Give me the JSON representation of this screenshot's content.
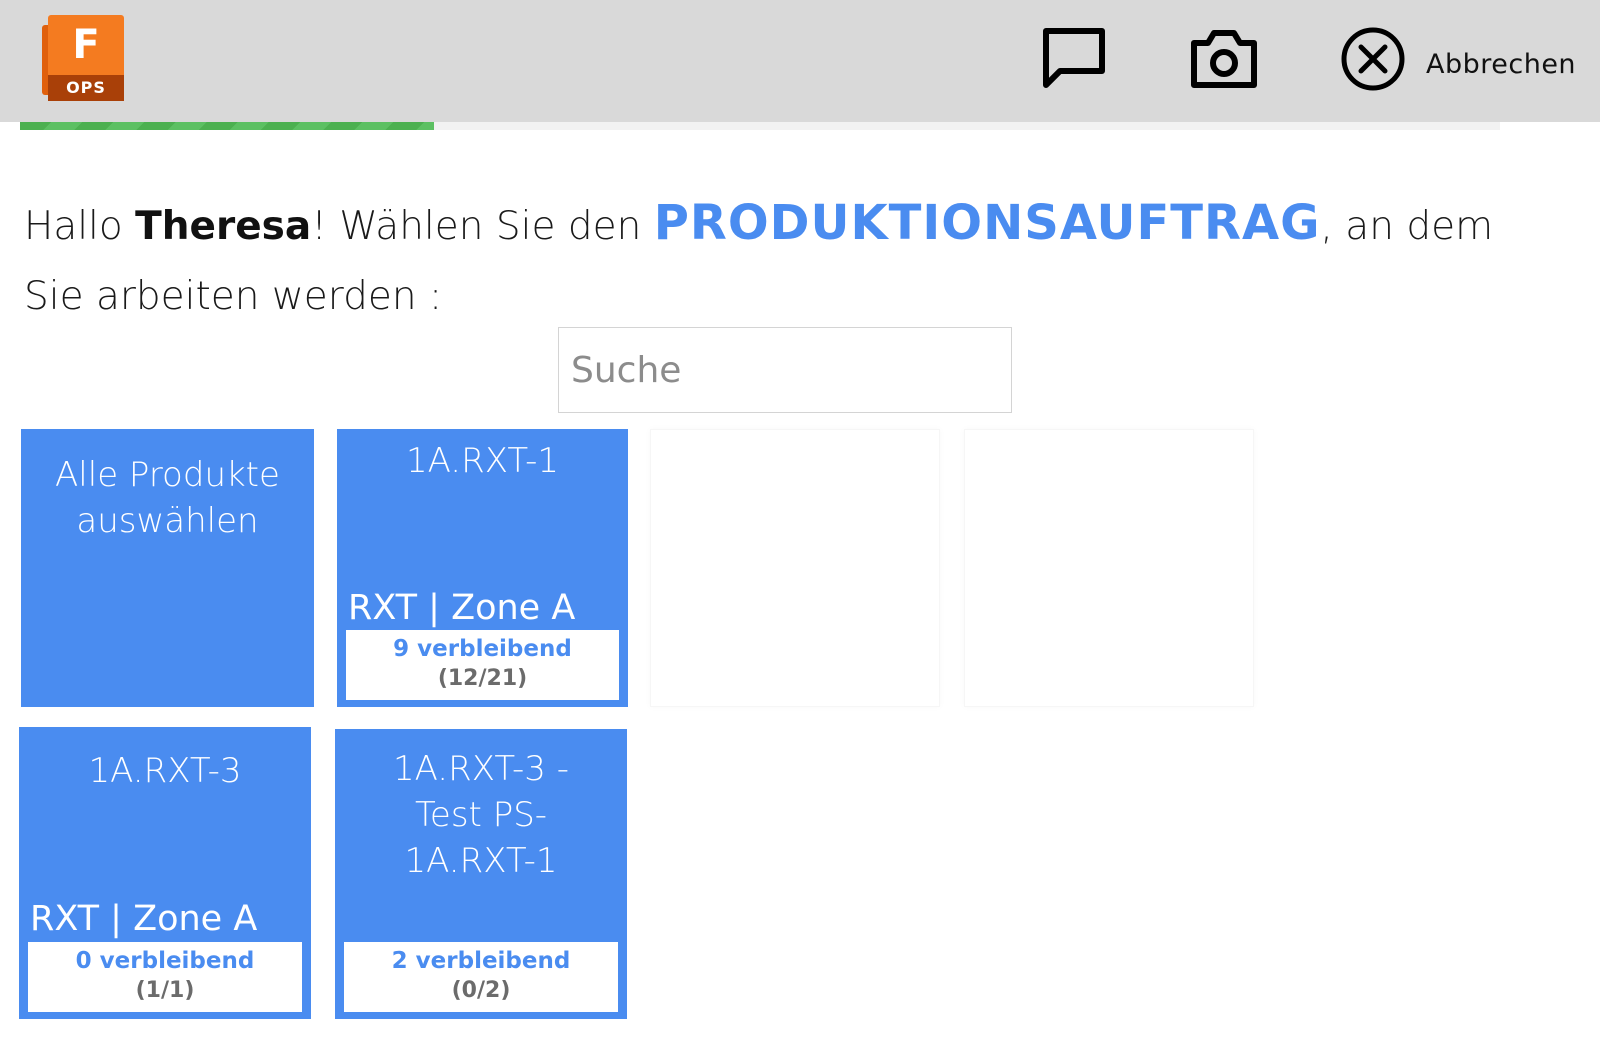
{
  "app": {
    "logo_letter": "F",
    "logo_badge": "OPS",
    "accent_color": "#4a8cf0",
    "progress_color": "#4cb050"
  },
  "header": {
    "icons": [
      "chat-icon",
      "camera-icon",
      "close-circle-icon"
    ],
    "cancel_label": "Abbrechen"
  },
  "progress": {
    "fraction": 0.28
  },
  "greeting": {
    "prefix": "Hallo ",
    "name": "Theresa",
    "mid": "! Wählen Sie den ",
    "keyword": "PRODUKTIONSAUFTRAG",
    "suffix": ", an dem Sie arbeiten werden :"
  },
  "search": {
    "placeholder": "Suche"
  },
  "tiles": [
    {
      "title": "Alle Produkte auswählen"
    },
    {
      "title": "1A.RXT-1",
      "zone": "RXT | Zone A",
      "remaining": "9 verbleibend",
      "count": "(12/21)"
    },
    {
      "title": "1A.RXT-3",
      "zone": "RXT | Zone A",
      "remaining": "0 verbleibend",
      "count": "(1/1)"
    },
    {
      "title": "1A.RXT-3 - Test PS-1A.RXT-1",
      "remaining": "2 verbleibend",
      "count": "(0/2)"
    }
  ]
}
